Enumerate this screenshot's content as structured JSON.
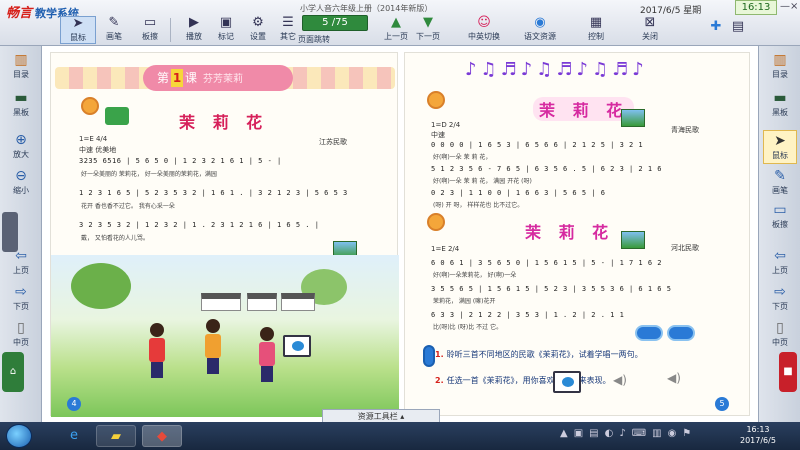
{
  "app": {
    "brand": "畅言",
    "brand_sub": "教学系统",
    "book_title": "小学人音六年级上册（2014年新版）",
    "date": "2017/6/5 星期",
    "clock": "16:13",
    "win_min": "—",
    "win_close": "×"
  },
  "toolbar": {
    "items": [
      {
        "label": "鼠标",
        "icon": "cursor-icon"
      },
      {
        "label": "画笔",
        "icon": "pen-icon"
      },
      {
        "label": "板擦",
        "icon": "eraser-icon"
      },
      {
        "label": "播放",
        "icon": "play-icon"
      },
      {
        "label": "标记",
        "icon": "mark-icon"
      },
      {
        "label": "设置",
        "icon": "settings-icon"
      },
      {
        "label": "其它",
        "icon": "more-icon"
      }
    ],
    "page_counter": "5 /75",
    "page_counter_label": "页面跳转",
    "prev_label": "上一页",
    "next_label": "下一页",
    "right_items": [
      {
        "label": "中英切换",
        "icon": "switch-icon"
      },
      {
        "label": "语文资源",
        "icon": "resource-icon"
      },
      {
        "label": "控制",
        "icon": "control-icon"
      },
      {
        "label": "关闭",
        "icon": "close-icon"
      }
    ]
  },
  "left_sidebar": {
    "items": [
      {
        "label": "目录",
        "icon": "book-icon"
      },
      {
        "label": "黑板",
        "icon": "blackboard-icon"
      },
      {
        "label": "放大",
        "icon": "zoom-in-icon"
      },
      {
        "label": "缩小",
        "icon": "zoom-out-icon"
      },
      {
        "label": "上页",
        "icon": "arrow-left-icon"
      },
      {
        "label": "下页",
        "icon": "arrow-right-icon"
      },
      {
        "label": "中页",
        "icon": "page-icon"
      }
    ]
  },
  "right_sidebar": {
    "items": [
      {
        "label": "目录",
        "icon": "book-icon"
      },
      {
        "label": "黑板",
        "icon": "blackboard-icon"
      },
      {
        "label": "鼠标",
        "icon": "cursor-icon"
      },
      {
        "label": "画笔",
        "icon": "pen-icon"
      },
      {
        "label": "板擦",
        "icon": "eraser-icon"
      },
      {
        "label": "上页",
        "icon": "arrow-left-icon"
      },
      {
        "label": "下页",
        "icon": "arrow-right-icon"
      },
      {
        "label": "中页",
        "icon": "page-icon"
      }
    ]
  },
  "left_page": {
    "lesson_prefix": "第",
    "lesson_num": "1",
    "lesson_suffix": "课",
    "lesson_name": "芬芳茉莉",
    "song_title": "茉 莉 花",
    "key": "1=E 4/4",
    "tempo": "中速  优美地",
    "source": "江苏民歌",
    "score": [
      "3235 6516 | 5 6 5 0 | 1 2 3 2 1 6 1 | 5 - |",
      "好一朵美丽的  茉莉花，  好一朵美丽的茉莉花，满园",
      "1 2 3 1 6 5 | 5 2 3 5 3 2 | 1 6 1 . | 3 2 1 2 3 | 5 6 5 3",
      "花开   香也香不过它。  我有心采一朵",
      "3 2 3 5 3 2 | 1 2 3 2 | 1 . 2 3 1 2 1 6 | 1 6 5 . |",
      "戴，  又怕看花的人儿骂。"
    ],
    "page_number": "4"
  },
  "right_page": {
    "song1_title": "茉 莉 花",
    "song1_key": "1=D 2/4",
    "song1_tempo": "中速",
    "song1_source": "青海民歌",
    "song1_score": [
      "0 0 0 0 | 1 6 5 3 | 6 5 6 6 | 2 1 2 5 | 3 2 1",
      "好(啊)一朵  茉  莉  花，",
      "5 1 2 3 5 6 - 7 6 5 | 6 3 5 6 . 5 | 6 2 3 | 2 1 6",
      "好(啊)一朵  茉 莉 花，  满园  开花  (呀)",
      "0 2 3 | 1 1 0 0 | 1 6 6 3 | 5 6 5 | 6",
      "(呀) 开 呀，  样样花也  比不过它。"
    ],
    "song2_title": "茉 莉 花",
    "song2_key": "1=E 2/4",
    "song2_source": "河北民歌",
    "song2_score": [
      "6 0 6 1 | 3 5 6 5 0 | 1 5 6 1 5 | 5 - | 1 7 1 6 2",
      "好(啊)一朵茉莉花，  好(啊)一朵",
      "3 5 5 6 5 | 1 5 6 1 5 | 5 2 3 | 3 5 5 3 6 | 6 1 6 5",
      "茉莉花，  满园  (嘛)花开",
      "6 3 3 | 2 1 2 2 | 3 5 3 | 1 . 2 | 2 . 1 1",
      "比(呀)比  (呀)比  不过  它。"
    ],
    "tasks": [
      {
        "n": "1.",
        "text": "聆听三首不同地区的民歌《茉莉花》，试着学唱一两句。"
      },
      {
        "n": "2.",
        "text": "任选一首《茉莉花》，用你喜欢的形式来表现。"
      }
    ],
    "page_number": "5"
  },
  "resource_bar": {
    "label": "资源工具栏"
  },
  "taskbar": {
    "items": [
      {
        "name": "ie-icon"
      },
      {
        "name": "folder-icon"
      },
      {
        "name": "app-icon"
      }
    ],
    "time": "16:13",
    "date": "2017/6/5"
  }
}
